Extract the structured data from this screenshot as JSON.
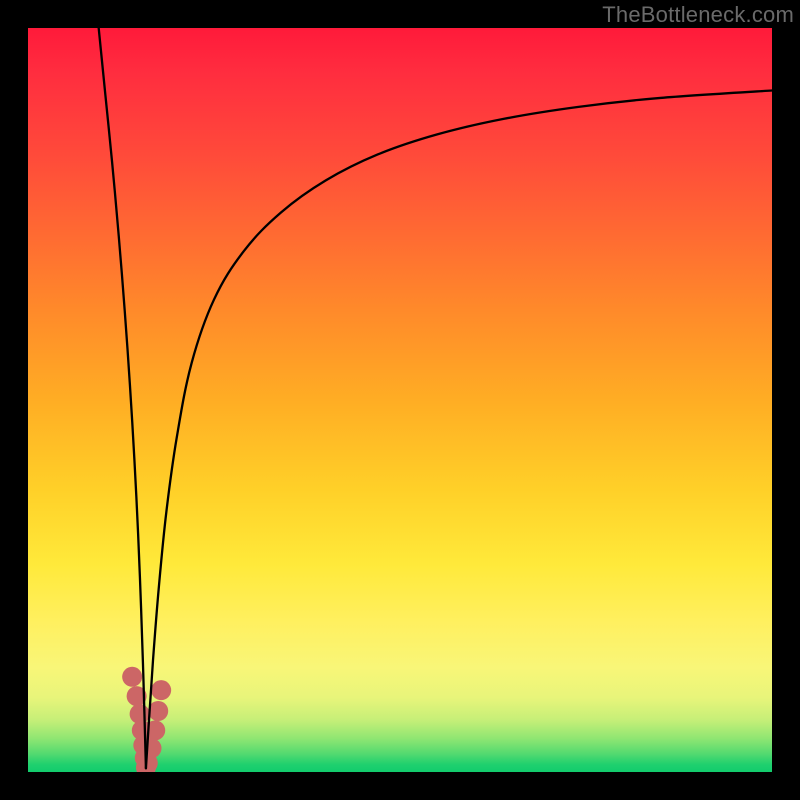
{
  "watermark": "TheBottleneck.com",
  "chart_data": {
    "type": "line",
    "title": "",
    "xlabel": "",
    "ylabel": "",
    "xlim": [
      0,
      100
    ],
    "ylim": [
      0,
      100
    ],
    "grid": false,
    "gradient_stops": [
      {
        "pos": 0.0,
        "color": "#ff1a3a"
      },
      {
        "pos": 0.06,
        "color": "#ff2d3f"
      },
      {
        "pos": 0.17,
        "color": "#ff4a3a"
      },
      {
        "pos": 0.28,
        "color": "#ff6b32"
      },
      {
        "pos": 0.38,
        "color": "#ff8a2a"
      },
      {
        "pos": 0.5,
        "color": "#ffad24"
      },
      {
        "pos": 0.62,
        "color": "#ffd028"
      },
      {
        "pos": 0.72,
        "color": "#ffe93a"
      },
      {
        "pos": 0.8,
        "color": "#fff060"
      },
      {
        "pos": 0.86,
        "color": "#f8f678"
      },
      {
        "pos": 0.9,
        "color": "#e8f57a"
      },
      {
        "pos": 0.93,
        "color": "#c6ef78"
      },
      {
        "pos": 0.955,
        "color": "#8fe672"
      },
      {
        "pos": 0.975,
        "color": "#55da70"
      },
      {
        "pos": 0.99,
        "color": "#1fd06e"
      },
      {
        "pos": 1.0,
        "color": "#12cc6d"
      }
    ],
    "series": [
      {
        "name": "left-branch",
        "color": "#000000",
        "stroke_width": 2.3,
        "x": [
          9.5,
          10.4,
          11.3,
          12.2,
          13.0,
          13.7,
          14.3,
          14.8,
          15.2,
          15.5,
          15.7,
          15.85
        ],
        "y": [
          100,
          91,
          82,
          72,
          62,
          52,
          42,
          32,
          22,
          13,
          6,
          0.5
        ]
      },
      {
        "name": "right-branch",
        "color": "#000000",
        "stroke_width": 2.3,
        "x": [
          15.85,
          16.2,
          16.8,
          17.6,
          18.6,
          20,
          22,
          25,
          29,
          34,
          40,
          47,
          55,
          64,
          74,
          85,
          100
        ],
        "y": [
          0.5,
          6,
          15,
          25,
          35,
          45,
          55,
          63.5,
          70,
          75.2,
          79.5,
          83,
          85.7,
          87.8,
          89.4,
          90.6,
          91.6
        ]
      },
      {
        "name": "marker-cluster",
        "color": "#cc6666",
        "type": "scatter",
        "marker_radius": 10,
        "x": [
          14.0,
          14.6,
          15.0,
          15.3,
          15.5,
          15.7,
          15.85,
          16.1,
          16.6,
          17.1,
          17.5,
          17.9
        ],
        "y": [
          12.8,
          10.2,
          7.8,
          5.6,
          3.6,
          1.9,
          0.6,
          1.2,
          3.2,
          5.6,
          8.2,
          11.0
        ]
      }
    ]
  }
}
